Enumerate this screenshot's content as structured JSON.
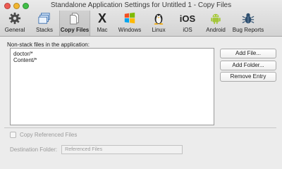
{
  "window": {
    "title": "Standalone Application Settings for Untitled 1 - Copy Files"
  },
  "toolbar": {
    "items": [
      {
        "label": "General",
        "icon": "gear-icon"
      },
      {
        "label": "Stacks",
        "icon": "stacks-icon"
      },
      {
        "label": "Copy Files",
        "icon": "copy-files-icon",
        "selected": true
      },
      {
        "label": "Mac",
        "icon": "mac-x-icon"
      },
      {
        "label": "Windows",
        "icon": "windows-logo-icon"
      },
      {
        "label": "Linux",
        "icon": "linux-penguin-icon"
      },
      {
        "label": "iOS",
        "icon": "ios-text-icon"
      },
      {
        "label": "Android",
        "icon": "android-robot-icon"
      },
      {
        "label": "Bug Reports",
        "icon": "bug-icon"
      }
    ],
    "ios_icon_text": "iOS",
    "mac_icon_text": "X"
  },
  "main": {
    "section_label": "Non-stack files in the application:",
    "files": [
      "doctor/*",
      "Content/*"
    ],
    "buttons": {
      "add_file": "Add File...",
      "add_folder": "Add Folder...",
      "remove_entry": "Remove Entry"
    },
    "copy_referenced_files": {
      "label": "Copy Referenced Files",
      "checked": false,
      "enabled": false
    },
    "destination_folder": {
      "label": "Destination Folder:",
      "value": "Referenced Files",
      "enabled": false
    }
  },
  "colors": {
    "close": "#ee5a52",
    "minimize": "#f2b631",
    "maximize": "#41bf48",
    "windows_red": "#f25022",
    "windows_green": "#7fba00",
    "windows_blue": "#00a4ef",
    "windows_yellow": "#ffb900",
    "android_green": "#a4c639"
  }
}
